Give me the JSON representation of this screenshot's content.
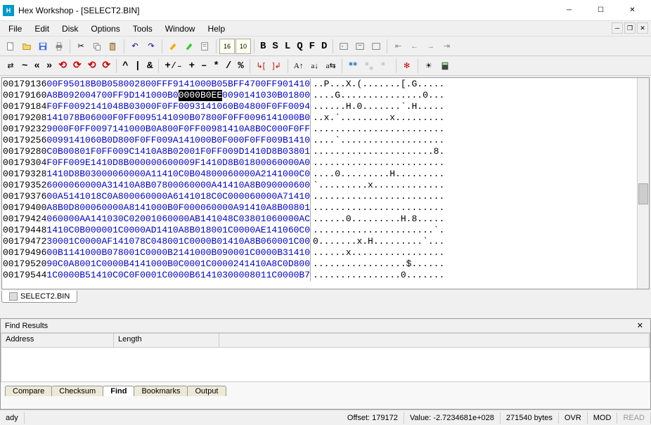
{
  "titlebar": {
    "title": "Hex Workshop - [SELECT2.BIN]"
  },
  "menus": [
    "File",
    "Edit",
    "Disk",
    "Options",
    "Tools",
    "Window",
    "Help"
  ],
  "toolbar2_letters": [
    "B",
    "S",
    "L",
    "Q",
    "F",
    "D"
  ],
  "hex": {
    "rows": [
      {
        "addr": "00179136",
        "b": [
          "00F9",
          "5018",
          "B0B0",
          "5800",
          "2800",
          "FFF9",
          "1410",
          "00B0",
          "5BFF",
          "4700",
          "FF90",
          "1410"
        ],
        "sel": [],
        "a": "..P...X.(.......[.G....."
      },
      {
        "addr": "00179160",
        "b": [
          "A8B0",
          "9200",
          "4700",
          "FF9D",
          "1410",
          "00B0",
          "0000",
          "B0EE",
          "0090",
          "1410",
          "30B0",
          "1800"
        ],
        "sel": [
          6,
          7
        ],
        "a": "....G...............0..."
      },
      {
        "addr": "00179184",
        "b": [
          "F0FF",
          "0092",
          "1410",
          "48B0",
          "3000",
          "F0FF",
          "0093",
          "1410",
          "60B0",
          "4800",
          "F0FF",
          "0094"
        ],
        "sel": [],
        "a": "......H.0.......`.H....."
      },
      {
        "addr": "00179208",
        "b": [
          "1410",
          "78B0",
          "6000",
          "F0FF",
          "0095",
          "1410",
          "90B0",
          "7800",
          "F0FF",
          "0096",
          "1410",
          "00B0"
        ],
        "sel": [],
        "a": "..x.`.........x........."
      },
      {
        "addr": "00179232",
        "b": [
          "9000",
          "F0FF",
          "0097",
          "1410",
          "00B0",
          "A800",
          "F0FF",
          "0098",
          "1410",
          "A8B0",
          "C000",
          "F0FF"
        ],
        "sel": [],
        "a": "........................"
      },
      {
        "addr": "00179256",
        "b": [
          "0099",
          "1410",
          "60B0",
          "D800",
          "F0FF",
          "009A",
          "1410",
          "00B0",
          "F000",
          "F0FF",
          "009B",
          "1410"
        ],
        "sel": [],
        "a": "....`..................."
      },
      {
        "addr": "00179280",
        "b": [
          "C0B0",
          "0801",
          "F0FF",
          "009C",
          "1410",
          "A8B0",
          "2001",
          "F0FF",
          "009D",
          "1410",
          "D8B0",
          "3801"
        ],
        "sel": [],
        "a": "......................8."
      },
      {
        "addr": "00179304",
        "b": [
          "F0FF",
          "009E",
          "1410",
          "D8B0",
          "0000",
          "0600",
          "009F",
          "1410",
          "D8B0",
          "1800",
          "0600",
          "00A0"
        ],
        "sel": [],
        "a": "........................"
      },
      {
        "addr": "00179328",
        "b": [
          "1410",
          "D8B0",
          "3000",
          "0600",
          "00A1",
          "1410",
          "C0B0",
          "4800",
          "0600",
          "00A2",
          "1410",
          "00C0"
        ],
        "sel": [],
        "a": "....0.........H........."
      },
      {
        "addr": "00179352",
        "b": [
          "6000",
          "0600",
          "00A3",
          "1410",
          "A8B0",
          "7800",
          "0600",
          "00A4",
          "1410",
          "A8B0",
          "9000",
          "0600"
        ],
        "sel": [],
        "a": "`.........x............."
      },
      {
        "addr": "00179376",
        "b": [
          "00A5",
          "1410",
          "18C0",
          "A800",
          "0600",
          "00A6",
          "1410",
          "18C0",
          "C000",
          "0600",
          "00A7",
          "1410"
        ],
        "sel": [],
        "a": "........................"
      },
      {
        "addr": "00179400",
        "b": [
          "A8B0",
          "D800",
          "0600",
          "00A8",
          "1410",
          "00B0",
          "F000",
          "0600",
          "00A9",
          "1410",
          "A8B0",
          "0801"
        ],
        "sel": [],
        "a": "........................"
      },
      {
        "addr": "00179424",
        "b": [
          "0600",
          "00AA",
          "1410",
          "30C0",
          "2001",
          "0600",
          "00AB",
          "1410",
          "48C0",
          "3801",
          "0600",
          "00AC"
        ],
        "sel": [],
        "a": "......0.........H.8....."
      },
      {
        "addr": "00179448",
        "b": [
          "1410",
          "C0B0",
          "0000",
          "1C00",
          "00AD",
          "1410",
          "A8B0",
          "1800",
          "1C00",
          "00AE",
          "1410",
          "60C0"
        ],
        "sel": [],
        "a": "......................`."
      },
      {
        "addr": "00179472",
        "b": [
          "3000",
          "1C00",
          "00AF",
          "1410",
          "78C0",
          "4800",
          "1C00",
          "00B0",
          "1410",
          "A8B0",
          "6000",
          "1C00"
        ],
        "sel": [],
        "a": "0.......x.H.........`..."
      },
      {
        "addr": "00179496",
        "b": [
          "00B1",
          "1410",
          "00B0",
          "7800",
          "1C00",
          "00B2",
          "1410",
          "00B0",
          "9000",
          "1C00",
          "00B3",
          "1410"
        ],
        "sel": [],
        "a": "......x................."
      },
      {
        "addr": "00179520",
        "b": [
          "90C0",
          "A800",
          "1C00",
          "00B4",
          "1410",
          "00B0",
          "C000",
          "1C00",
          "0024",
          "1410",
          "A8C0",
          "D800"
        ],
        "sel": [],
        "a": ".................$......"
      },
      {
        "addr": "00179544",
        "b": [
          "1C00",
          "00B5",
          "1410",
          "C0C0",
          "F000",
          "1C00",
          "00B6",
          "1410",
          "3000",
          "0801",
          "1C00",
          "00B7"
        ],
        "sel": [],
        "a": "................0......."
      }
    ]
  },
  "doc_tab": "SELECT2.BIN",
  "find": {
    "title": "Find Results",
    "cols": {
      "addr": "Address",
      "len": "Length"
    },
    "tabs": [
      "Compare",
      "Checksum",
      "Find",
      "Bookmarks",
      "Output"
    ],
    "active_tab": 2
  },
  "status": {
    "ready": "ady",
    "offset": "Offset: 179172",
    "value": "Value: -2.7234681e+028",
    "bytes": "271540 bytes",
    "ovr": "OVR",
    "mod": "MOD",
    "read": "READ"
  }
}
